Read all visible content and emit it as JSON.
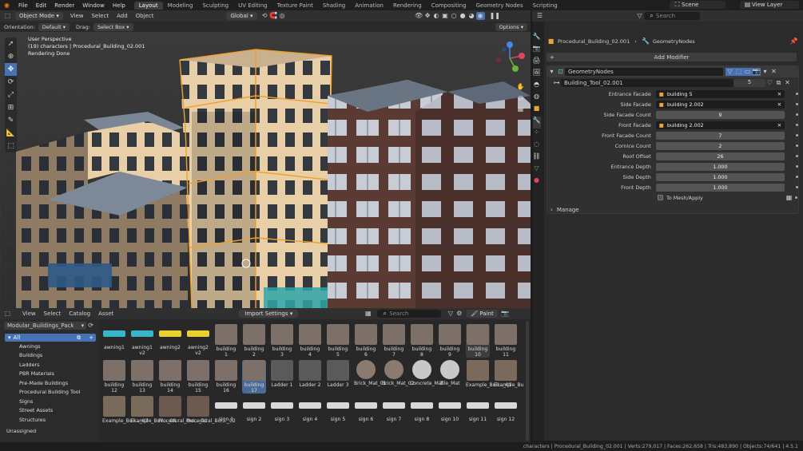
{
  "menu": [
    "File",
    "Edit",
    "Render",
    "Window",
    "Help"
  ],
  "workspaces": [
    "Layout",
    "Modeling",
    "Sculpting",
    "UV Editing",
    "Texture Paint",
    "Shading",
    "Animation",
    "Rendering",
    "Compositing",
    "Geometry Nodes",
    "Scripting"
  ],
  "scene": "Scene",
  "view_layer": "View Layer",
  "viewport": {
    "mode": "Object Mode",
    "menus": [
      "View",
      "Select",
      "Add",
      "Object"
    ],
    "transform": "Global",
    "orientation_label": "Orientation:",
    "orientation": "Default",
    "drag_label": "Drag:",
    "drag": "Select Box",
    "options": "Options",
    "overlay_lines": [
      "User Perspective",
      "(19) characters | Procedural_Building_02.001",
      "Rendering Done"
    ]
  },
  "properties": {
    "search": "Search",
    "breadcrumb_obj": "Procedural_Building_02.001",
    "breadcrumb_mod": "GeometryNodes",
    "add_modifier": "Add Modifier",
    "modifier_name": "GeometryNodes",
    "node_group": "Building_Tool_02.001",
    "node_users": "5",
    "rows": [
      {
        "label": "Entrance Facade",
        "value": "building 5",
        "kind": "obj"
      },
      {
        "label": "Side Facade",
        "value": "building 2.002",
        "kind": "obj"
      },
      {
        "label": "Side Facade Count",
        "value": "9",
        "kind": "num"
      },
      {
        "label": "Front Facade",
        "value": "building 2.002",
        "kind": "obj"
      },
      {
        "label": "Front Facade Count",
        "value": "7",
        "kind": "num"
      },
      {
        "label": "Cornice Count",
        "value": "2",
        "kind": "num"
      },
      {
        "label": "Roof Offset",
        "value": "26",
        "kind": "num"
      },
      {
        "label": "Entrance Depth",
        "value": "1.000",
        "kind": "num"
      },
      {
        "label": "Side Depth",
        "value": "1.000",
        "kind": "num"
      },
      {
        "label": "Front Depth",
        "value": "1.000",
        "kind": "num"
      }
    ],
    "to_mesh": "To Mesh/Apply",
    "manage": "Manage"
  },
  "assets": {
    "menus": [
      "View",
      "Select",
      "Catalog",
      "Asset"
    ],
    "library": "Modular_Buildings_Pack",
    "import": "Import Settings",
    "search": "Search",
    "paint": "Paint",
    "catalogs": [
      "All",
      "Awnings",
      "Buildings",
      "Ladders",
      "PBR Materials",
      "Pre-Made Buildings",
      "Procedural Building Tool",
      "Signs",
      "Street Assets",
      "Structures",
      "Unassigned"
    ],
    "row1": [
      "awning1",
      "awning1 v2",
      "awning2",
      "awning2 v2",
      "building 1",
      "building 2",
      "building 3",
      "building 4",
      "building 5",
      "building 6",
      "building 7",
      "building 8",
      "building 9",
      "building 10",
      "building 11"
    ],
    "row2": [
      "building 12",
      "building 13",
      "building 14",
      "building 15",
      "building 16",
      "building 17",
      "Ladder 1",
      "Ladder 2",
      "Ladder 3",
      "Brick_Mat_01",
      "Brick_Mat_02",
      "Concrete_Mat",
      "Tile_Mat",
      "Example_Buil..._01",
      "Example_Buil..._02"
    ],
    "row3": [
      "Example_Buil..._03",
      "Example_Buil..._04",
      "Procedural_Bui..._01",
      "Procedural_Bui..._02",
      "sign 1",
      "sign 2",
      "sign 3",
      "sign 4",
      "sign 5",
      "sign 6",
      "sign 7",
      "sign 8",
      "sign 10",
      "sign 11",
      "sign 12"
    ]
  },
  "status": "characters | Procedural_Building_02.001 | Verts:279,017 | Faces:262,658 | Tris:483,890 | Objects:74/641 | 4.5.1"
}
